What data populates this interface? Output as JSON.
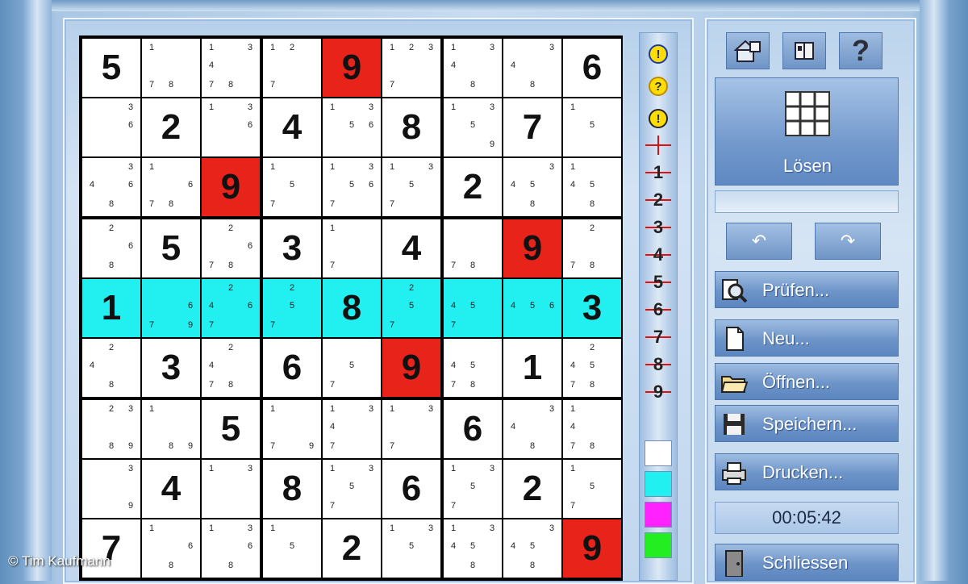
{
  "window": {
    "credit": "© Tim Kaufmann"
  },
  "grid": {
    "rows": [
      [
        {
          "v": "5"
        },
        {
          "c": [
            1,
            7,
            8
          ]
        },
        {
          "c": [
            1,
            3,
            4,
            7,
            8
          ]
        },
        {
          "c": [
            1,
            2,
            7
          ]
        },
        {
          "v": "9",
          "red": true
        },
        {
          "c": [
            1,
            2,
            3,
            7
          ]
        },
        {
          "c": [
            1,
            3,
            4,
            8
          ]
        },
        {
          "c": [
            3,
            4,
            8
          ]
        },
        {
          "v": "6"
        }
      ],
      [
        {
          "c": [
            3,
            6
          ]
        },
        {
          "v": "2"
        },
        {
          "c": [
            1,
            3,
            6
          ]
        },
        {
          "v": "4"
        },
        {
          "c": [
            1,
            3,
            5,
            6
          ]
        },
        {
          "v": "8"
        },
        {
          "c": [
            1,
            3,
            5,
            9
          ]
        },
        {
          "v": "7"
        },
        {
          "c": [
            1,
            5
          ]
        }
      ],
      [
        {
          "c": [
            3,
            4,
            6,
            8
          ]
        },
        {
          "c": [
            1,
            6,
            7,
            8
          ]
        },
        {
          "v": "9",
          "red": true
        },
        {
          "c": [
            1,
            5,
            7
          ]
        },
        {
          "c": [
            1,
            3,
            5,
            6,
            7
          ]
        },
        {
          "c": [
            1,
            3,
            5,
            7
          ]
        },
        {
          "v": "2"
        },
        {
          "c": [
            3,
            4,
            5,
            8
          ]
        },
        {
          "c": [
            1,
            4,
            5,
            8
          ]
        }
      ],
      [
        {
          "c": [
            2,
            6,
            8
          ]
        },
        {
          "v": "5"
        },
        {
          "c": [
            2,
            6,
            7,
            8
          ]
        },
        {
          "v": "3"
        },
        {
          "c": [
            1,
            7
          ]
        },
        {
          "v": "4"
        },
        {
          "c": [
            7,
            8
          ]
        },
        {
          "v": "9",
          "red": true
        },
        {
          "c": [
            2,
            7,
            8
          ]
        }
      ],
      [
        {
          "v": "1",
          "hl": true
        },
        {
          "c": [
            6,
            7,
            9
          ],
          "hl": true
        },
        {
          "c": [
            2,
            4,
            6,
            7
          ],
          "hl": true
        },
        {
          "c": [
            2,
            5,
            7
          ],
          "hl": true
        },
        {
          "v": "8",
          "hl": true
        },
        {
          "c": [
            2,
            5,
            7
          ],
          "hl": true
        },
        {
          "c": [
            4,
            5,
            7
          ],
          "hl": true
        },
        {
          "c": [
            4,
            5,
            6
          ],
          "hl": true
        },
        {
          "v": "3",
          "hl": true
        }
      ],
      [
        {
          "c": [
            2,
            4,
            8
          ]
        },
        {
          "v": "3"
        },
        {
          "c": [
            2,
            4,
            7,
            8
          ]
        },
        {
          "v": "6"
        },
        {
          "c": [
            5,
            7
          ]
        },
        {
          "v": "9",
          "red": true
        },
        {
          "c": [
            4,
            5,
            7,
            8
          ]
        },
        {
          "v": "1"
        },
        {
          "c": [
            2,
            4,
            5,
            7,
            8
          ]
        }
      ],
      [
        {
          "c": [
            2,
            3,
            8,
            9
          ]
        },
        {
          "c": [
            1,
            8,
            9
          ]
        },
        {
          "v": "5"
        },
        {
          "c": [
            1,
            7,
            9
          ]
        },
        {
          "c": [
            1,
            3,
            4,
            7
          ]
        },
        {
          "c": [
            1,
            3,
            7
          ]
        },
        {
          "v": "6"
        },
        {
          "c": [
            3,
            4,
            8
          ]
        },
        {
          "c": [
            1,
            4,
            7,
            8
          ]
        }
      ],
      [
        {
          "c": [
            3,
            9
          ]
        },
        {
          "v": "4"
        },
        {
          "c": [
            1,
            3
          ]
        },
        {
          "v": "8"
        },
        {
          "c": [
            1,
            3,
            5,
            7
          ]
        },
        {
          "v": "6"
        },
        {
          "c": [
            1,
            3,
            5,
            7
          ]
        },
        {
          "v": "2"
        },
        {
          "c": [
            1,
            5,
            7
          ]
        }
      ],
      [
        {
          "v": "7"
        },
        {
          "c": [
            1,
            6,
            8
          ]
        },
        {
          "c": [
            1,
            3,
            6,
            8
          ]
        },
        {
          "c": [
            1,
            5
          ]
        },
        {
          "v": "2"
        },
        {
          "c": [
            1,
            3,
            5
          ]
        },
        {
          "c": [
            1,
            3,
            4,
            5,
            8
          ]
        },
        {
          "c": [
            3,
            4,
            5,
            8
          ]
        },
        {
          "v": "9",
          "red": true
        }
      ]
    ]
  },
  "tools": {
    "top": [
      {
        "name": "hint-icon",
        "glyph": "!",
        "bg": "#ffdd00",
        "ring": "#1a3aa8"
      },
      {
        "name": "question-icon",
        "glyph": "?",
        "bg": "#ffdd00",
        "ring": "#c08a00"
      },
      {
        "name": "alert-icon",
        "glyph": "!",
        "bg": "#ffdd00",
        "ring": "#222222"
      }
    ],
    "numbers": [
      "",
      "1",
      "2",
      "3",
      "4",
      "5",
      "6",
      "7",
      "8",
      "9"
    ],
    "swatches": [
      "#ffffff",
      "#22f0f0",
      "#ff22ff",
      "#22ee22"
    ]
  },
  "sidebar": {
    "solve_label": "Lösen",
    "menu": [
      {
        "id": "pruefen",
        "label": "Prüfen..."
      },
      {
        "id": "neu",
        "label": "Neu..."
      },
      {
        "id": "oeffnen",
        "label": "Öffnen..."
      },
      {
        "id": "speichern",
        "label": "Speichern..."
      },
      {
        "id": "drucken",
        "label": "Drucken..."
      }
    ],
    "timer": "00:05:42",
    "close_label": "Schliessen"
  }
}
